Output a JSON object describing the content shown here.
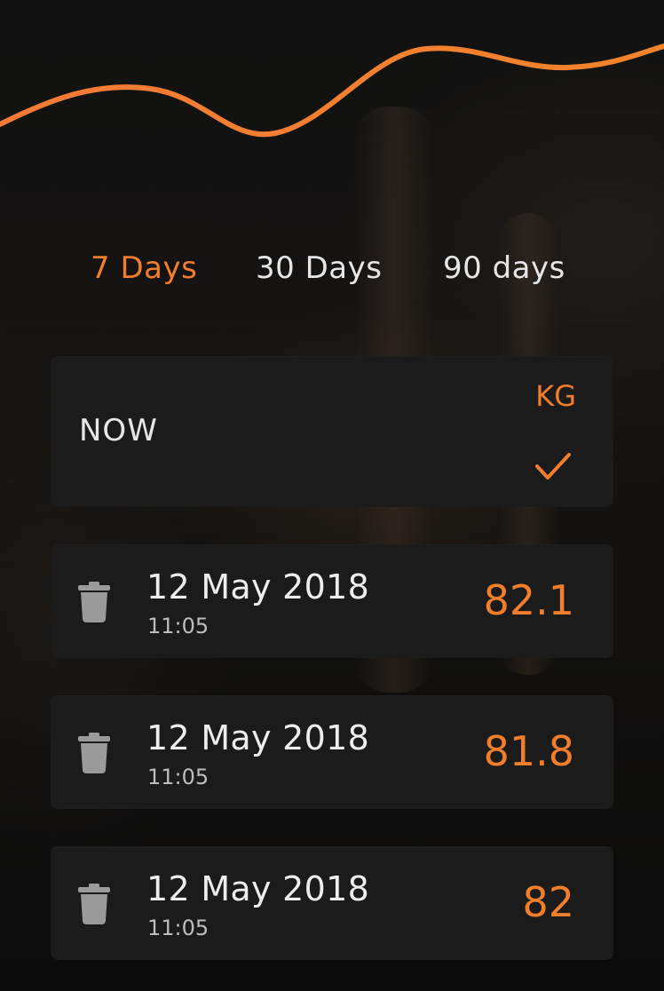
{
  "colors": {
    "accent": "#f07e2c",
    "card_bg": "#1b1b1b",
    "text_primary": "#e6e6e6",
    "text_secondary": "#bdbdbd",
    "icon_gray": "#9a9a9a"
  },
  "tabs": [
    {
      "label": "7 Days",
      "active": true
    },
    {
      "label": "30 Days",
      "active": false
    },
    {
      "label": "90 days",
      "active": false
    }
  ],
  "now_card": {
    "label": "NOW",
    "unit": "KG",
    "confirm_icon": "check-icon"
  },
  "entries": [
    {
      "date": "12 May 2018",
      "time": "11:05",
      "value": "82.1",
      "icon": "trash-icon"
    },
    {
      "date": "12 May 2018",
      "time": "11:05",
      "value": "81.8",
      "icon": "trash-icon"
    },
    {
      "date": "12 May 2018",
      "time": "11:05",
      "value": "82",
      "icon": "trash-icon"
    }
  ]
}
